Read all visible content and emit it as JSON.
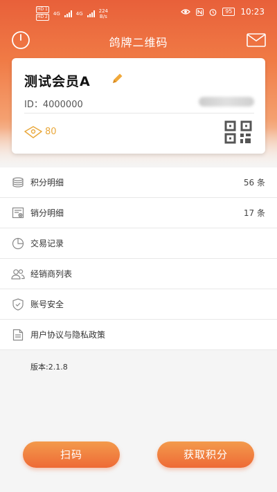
{
  "status_bar": {
    "sim1": "HD 1",
    "sim2": "HD 2",
    "net1": "4G",
    "net2": "4G",
    "speed_value": "224",
    "speed_unit": "B/s",
    "battery": "95",
    "time": "10:23"
  },
  "header": {
    "title": "鸽牌二维码"
  },
  "card": {
    "member_name": "测试会员A",
    "member_id": "ID：4000000",
    "points": "80"
  },
  "menu": {
    "items": [
      {
        "label": "积分明细",
        "count": "56 条"
      },
      {
        "label": "销分明细",
        "count": "17 条"
      },
      {
        "label": "交易记录",
        "count": ""
      },
      {
        "label": "经销商列表",
        "count": ""
      },
      {
        "label": "账号安全",
        "count": ""
      },
      {
        "label": "用户协议与隐私政策",
        "count": ""
      }
    ]
  },
  "version": "版本:2.1.8",
  "buttons": {
    "scan": "扫码",
    "earn": "获取积分"
  },
  "colors": {
    "accent": "#ee6a36",
    "points": "#e9a83c"
  }
}
